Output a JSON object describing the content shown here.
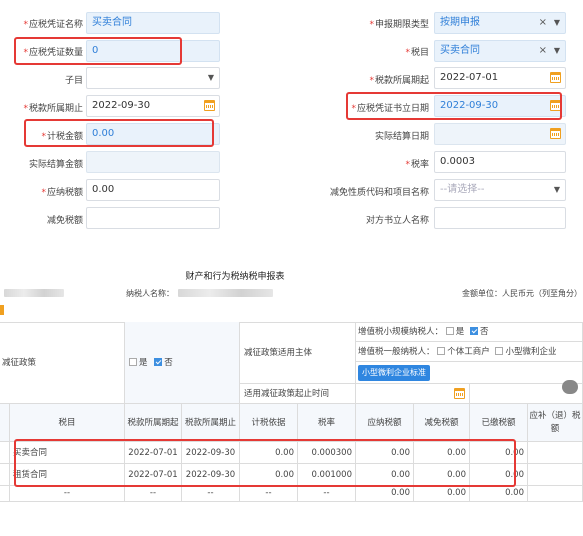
{
  "form": {
    "certificate_name": {
      "label": "应税凭证名称",
      "value": "买卖合同"
    },
    "period_type": {
      "label": "申报期限类型",
      "value": "按期申报"
    },
    "certificate_count": {
      "label": "应税凭证数量",
      "value": "0"
    },
    "tax_item": {
      "label": "税目",
      "value": "买卖合同"
    },
    "sub_item": {
      "label": "子目",
      "value": ""
    },
    "period_start": {
      "label": "税款所属期起",
      "value": "2022-07-01"
    },
    "period_end": {
      "label": "税款所属期止",
      "value": "2022-09-30"
    },
    "document_date": {
      "label": "应税凭证书立日期",
      "value": "2022-09-30"
    },
    "taxable_amount": {
      "label": "计税金额",
      "value": "0.00"
    },
    "settlement_date": {
      "label": "实际结算日期",
      "value": ""
    },
    "settlement_amount": {
      "label": "实际结算金额",
      "value": ""
    },
    "tax_rate": {
      "label": "税率",
      "value": "0.0003"
    },
    "tax_payable": {
      "label": "应纳税额",
      "value": "0.00"
    },
    "exemption_code": {
      "label": "减免性质代码和项目名称",
      "placeholder": "--请选择--"
    },
    "exemption_amount": {
      "label": "减免税额",
      "value": ""
    },
    "counterparty_name": {
      "label": "对方书立人名称",
      "value": ""
    },
    "clear_symbol": "×",
    "dropdown_symbol": "▼"
  },
  "report": {
    "title": "财产和行为税纳税申报表",
    "taxpayer_label": "纳税人名称：",
    "unit_label": "金额单位：人民币元（列至角分）",
    "policy_label": "减征政策",
    "policy_yes": "是",
    "policy_no": "否",
    "applicable_subject": "减征政策适用主体",
    "small_scale_label": "增值税小规模纳税人：",
    "general_label": "增值税一般纳税人：",
    "individual_label": "个体工商户",
    "micro_label": "小型微利企业",
    "micro_btn": "小型微利企业标准",
    "policy_end_label": "适用减征政策起止时间",
    "columns": [
      "税目",
      "税款所属期起",
      "税款所属期止",
      "计税依据",
      "税率",
      "应纳税额",
      "减免税额",
      "已缴税额",
      "应补（退）税额"
    ],
    "rows": [
      {
        "item": "买卖合同",
        "start": "2022-07-01",
        "end": "2022-09-30",
        "basis": "0.00",
        "rate": "0.000300",
        "payable": "0.00",
        "reduction": "0.00",
        "paid": "0.00"
      },
      {
        "item": "租赁合同",
        "start": "2022-07-01",
        "end": "2022-09-30",
        "basis": "0.00",
        "rate": "0.001000",
        "payable": "0.00",
        "reduction": "0.00",
        "paid": "0.00"
      },
      {
        "item": "--",
        "start": "--",
        "end": "--",
        "basis": "--",
        "rate": "--",
        "payable": "0.00",
        "reduction": "0.00",
        "paid": "0.00"
      }
    ]
  },
  "colors": {
    "highlight": "#e53935",
    "accent": "#2f86e0",
    "readonly_bg": "#e9f2fb"
  }
}
